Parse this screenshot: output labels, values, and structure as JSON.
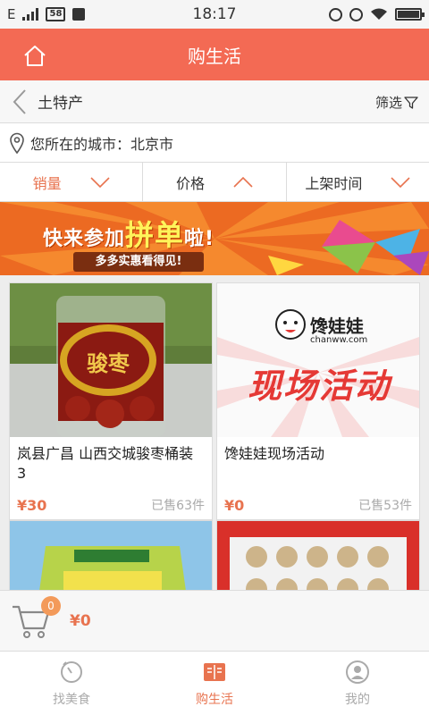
{
  "status_bar": {
    "network": "E",
    "badge": "58",
    "time": "18:17"
  },
  "header": {
    "title": "购生活"
  },
  "subnav": {
    "title": "土特产",
    "filter_label": "筛选"
  },
  "location": {
    "label": "您所在的城市：北京市"
  },
  "sort_tabs": [
    {
      "label": "销量",
      "active": true
    },
    {
      "label": "价格",
      "active": false
    },
    {
      "label": "上架时间",
      "active": false
    }
  ],
  "banner": {
    "headline_pre": "快来参加",
    "headline_big": "拼单",
    "headline_post": "啦!",
    "subline": "多多实惠看得见!"
  },
  "products": [
    {
      "name": "岚县广昌 山西交城骏枣桶装 3",
      "price": "¥30",
      "sold": "已售63件",
      "image_text": "骏枣"
    },
    {
      "name": "馋娃娃现场活动",
      "price": "¥0",
      "sold": "已售53件",
      "image_text": "现场活动",
      "logo_text": "馋娃娃",
      "logo_url": "chanww.com"
    },
    {
      "name": "",
      "price": "",
      "sold": ""
    },
    {
      "name": "",
      "price": "",
      "sold": ""
    }
  ],
  "cart": {
    "count": "0",
    "total": "¥0"
  },
  "bottom_nav": [
    {
      "label": "找美食",
      "icon": "clock-icon",
      "active": false
    },
    {
      "label": "购生活",
      "icon": "book-icon",
      "active": true
    },
    {
      "label": "我的",
      "icon": "user-icon",
      "active": false
    }
  ],
  "colors": {
    "brand": "#f36a54",
    "accent": "#e8734f"
  }
}
